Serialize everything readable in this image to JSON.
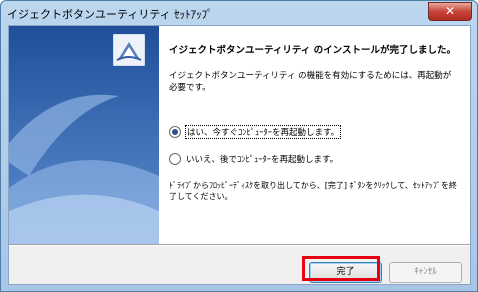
{
  "window": {
    "title": "イジェクトボタンユーティリティ ｾｯﾄｱｯﾌﾟ",
    "close_glyph": "✕"
  },
  "content": {
    "heading": "イジェクトボタンユーティリティ のインストールが完了しました。",
    "description": "イジェクトボタンユーティリティ の機能を有効にするためには、再起動が必要です。",
    "options": [
      {
        "label": "はい、今すぐｺﾝﾋﾟｭｰﾀｰを再起動します。",
        "checked": true
      },
      {
        "label": "いいえ、後でｺﾝﾋﾟｭｰﾀｰを再起動します。",
        "checked": false
      }
    ],
    "note": "ﾄﾞﾗｲﾌﾞからﾌﾛｯﾋﾟｰﾃﾞｨｽｸを取り出してから、[完了] ﾎﾞﾀﾝをｸﾘｯｸして、ｾｯﾄｱｯﾌﾟを終了してください。"
  },
  "buttons": {
    "finish": "完了",
    "cancel": "ｷｬﾝｾﾙ"
  },
  "colors": {
    "highlight": "#e60012",
    "sidebar": "#2f5fa8",
    "titlebar": "#bcd6ee"
  },
  "icons": {
    "product": "product-logo-icon",
    "sidebar_art": "wave-artwork"
  }
}
